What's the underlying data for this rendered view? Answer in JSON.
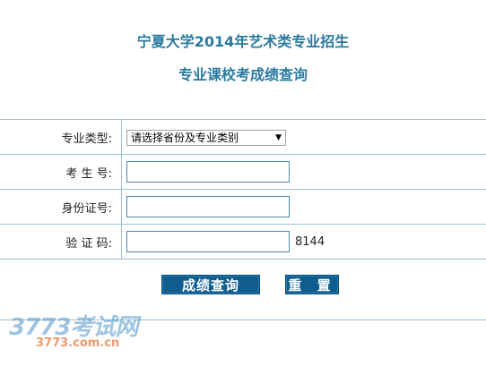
{
  "header": {
    "title_line1": "宁夏大学2014年艺术类专业招生",
    "title_line2": "专业课校考成绩查询"
  },
  "form": {
    "major_type_label": "专业类型:",
    "major_type_selected": "请选择省份及专业类别",
    "exam_number_label": "考 生 号:",
    "exam_number_value": "",
    "id_number_label": "身份证号:",
    "id_number_value": "",
    "captcha_label": "验 证 码:",
    "captcha_value": "",
    "captcha_code": "8144"
  },
  "buttons": {
    "query_label": "成绩查询",
    "reset_label": "重 置"
  },
  "watermark": {
    "main": "3773考试网",
    "sub": "3773.com.cn"
  }
}
